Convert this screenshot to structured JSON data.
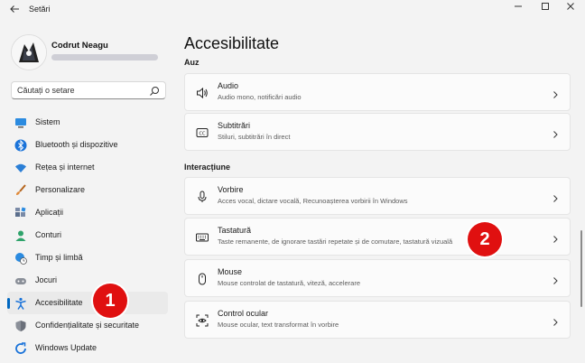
{
  "window": {
    "title": "Setări",
    "controls": {
      "minimize": "–",
      "maximize": "☐",
      "close": "✕"
    }
  },
  "profile": {
    "name": "Codrut Neagu"
  },
  "search": {
    "placeholder": "Căutați o setare"
  },
  "sidebar": {
    "items": [
      {
        "label": "Sistem",
        "icon": "system-icon",
        "active": false
      },
      {
        "label": "Bluetooth și dispozitive",
        "icon": "bluetooth-icon",
        "active": false
      },
      {
        "label": "Rețea și internet",
        "icon": "wifi-icon",
        "active": false
      },
      {
        "label": "Personalizare",
        "icon": "brush-icon",
        "active": false
      },
      {
        "label": "Aplicații",
        "icon": "apps-icon",
        "active": false
      },
      {
        "label": "Conturi",
        "icon": "person-icon",
        "active": false
      },
      {
        "label": "Timp și limbă",
        "icon": "clock-globe-icon",
        "active": false
      },
      {
        "label": "Jocuri",
        "icon": "gamepad-icon",
        "active": false
      },
      {
        "label": "Accesibilitate",
        "icon": "accessibility-icon",
        "active": true
      },
      {
        "label": "Confidențialitate și securitate",
        "icon": "shield-icon",
        "active": false
      },
      {
        "label": "Windows Update",
        "icon": "update-icon",
        "active": false
      }
    ]
  },
  "main": {
    "title": "Accesibilitate",
    "sections": [
      {
        "header": "Auz",
        "cards": [
          {
            "title": "Audio",
            "subtitle": "Audio mono, notificări audio",
            "icon": "speaker-icon"
          },
          {
            "title": "Subtitrări",
            "subtitle": "Stiluri, subtitrări în direct",
            "icon": "cc-icon"
          }
        ]
      },
      {
        "header": "Interacțiune",
        "cards": [
          {
            "title": "Vorbire",
            "subtitle": "Acces vocal, dictare vocală, Recunoașterea vorbirii în Windows",
            "icon": "microphone-icon"
          },
          {
            "title": "Tastatură",
            "subtitle": "Taste remanente, de ignorare tastări repetate și de comutare, tastatură vizuală",
            "icon": "keyboard-icon"
          },
          {
            "title": "Mouse",
            "subtitle": "Mouse controlat de tastatură, viteză, accelerare",
            "icon": "mouse-icon"
          },
          {
            "title": "Control ocular",
            "subtitle": "Mouse ocular, text transformat în vorbire",
            "icon": "eye-control-icon"
          }
        ]
      }
    ]
  },
  "annotations": [
    {
      "label": "1",
      "color": "#e01010"
    },
    {
      "label": "2",
      "color": "#e01010"
    }
  ],
  "colors": {
    "accent": "#0067c0",
    "badge": "#e01010"
  }
}
